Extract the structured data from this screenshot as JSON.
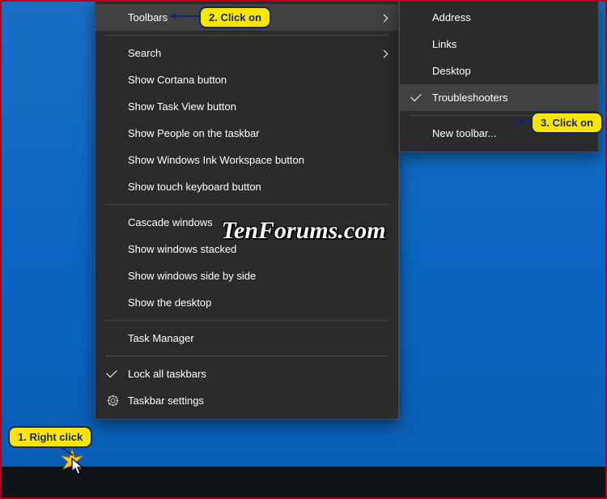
{
  "mainMenu": {
    "sections": [
      [
        {
          "key": "toolbars",
          "label": "Toolbars",
          "hasSubmenu": true,
          "hover": true
        }
      ],
      [
        {
          "key": "search",
          "label": "Search",
          "hasSubmenu": true
        },
        {
          "key": "cortana",
          "label": "Show Cortana button"
        },
        {
          "key": "taskview",
          "label": "Show Task View button"
        },
        {
          "key": "people",
          "label": "Show People on the taskbar"
        },
        {
          "key": "ink",
          "label": "Show Windows Ink Workspace button"
        },
        {
          "key": "touchkb",
          "label": "Show touch keyboard button"
        }
      ],
      [
        {
          "key": "cascade",
          "label": "Cascade windows"
        },
        {
          "key": "stacked",
          "label": "Show windows stacked"
        },
        {
          "key": "sidebyside",
          "label": "Show windows side by side"
        },
        {
          "key": "showdesktop",
          "label": "Show the desktop"
        }
      ],
      [
        {
          "key": "taskmgr",
          "label": "Task Manager"
        }
      ],
      [
        {
          "key": "lock",
          "label": "Lock all taskbars",
          "checked": true
        },
        {
          "key": "settings",
          "label": "Taskbar settings",
          "icon": "gear"
        }
      ]
    ]
  },
  "subMenu": {
    "sections": [
      [
        {
          "key": "address",
          "label": "Address"
        },
        {
          "key": "links",
          "label": "Links"
        },
        {
          "key": "desktop",
          "label": "Desktop"
        },
        {
          "key": "troubleshooters",
          "label": "Troubleshooters",
          "checked": true,
          "hover": true
        }
      ],
      [
        {
          "key": "newtoolbar",
          "label": "New toolbar..."
        }
      ]
    ]
  },
  "callouts": {
    "c1": "1. Right click",
    "c2": "2. Click on",
    "c3": "3. Click on"
  },
  "watermark": "TenForums.com"
}
